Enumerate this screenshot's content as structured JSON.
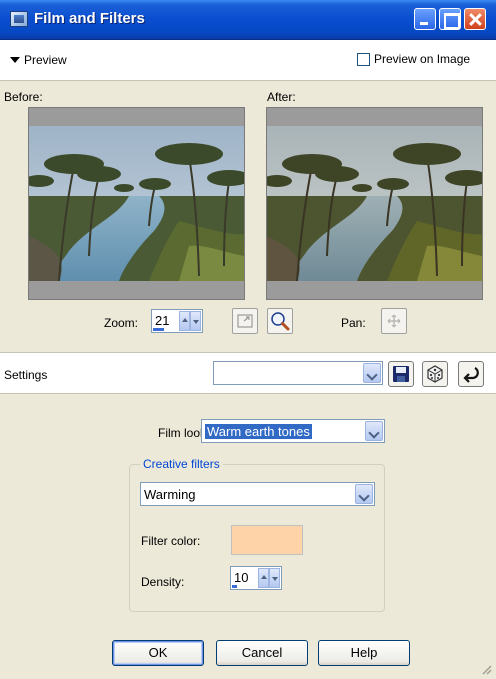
{
  "window": {
    "title": "Film and Filters"
  },
  "preview": {
    "toggle_label": "Preview",
    "preview_on_image_label": "Preview on Image",
    "preview_on_image_checked": false,
    "before_label": "Before:",
    "after_label": "After:",
    "zoom_label": "Zoom:",
    "zoom_value": "21",
    "pan_label": "Pan:"
  },
  "settings": {
    "label": "Settings",
    "preset_value": ""
  },
  "film_looks": {
    "label": "Film looks:",
    "value": "Warm earth tones"
  },
  "creative_filters": {
    "group_title": "Creative filters",
    "filter_value": "Warming",
    "filter_color_label": "Filter color:",
    "filter_color": "#ffd3a8",
    "density_label": "Density:",
    "density_value": "10"
  },
  "buttons": {
    "ok": "OK",
    "cancel": "Cancel",
    "help": "Help"
  },
  "icons": {
    "title": "film-filter-app-icon",
    "preview_toggle": "triangle-down-icon",
    "zoom_fit": "zoom-fit-icon",
    "zoom_magnify": "magnifier-icon",
    "pan": "pan-icon",
    "save": "floppy-disk-icon",
    "randomize": "dice-icon",
    "reset": "reset-arrow-icon"
  },
  "colors": {
    "titlebar": "#0a4ed0",
    "accent": "#316ac5",
    "group_title": "#0046d5"
  }
}
